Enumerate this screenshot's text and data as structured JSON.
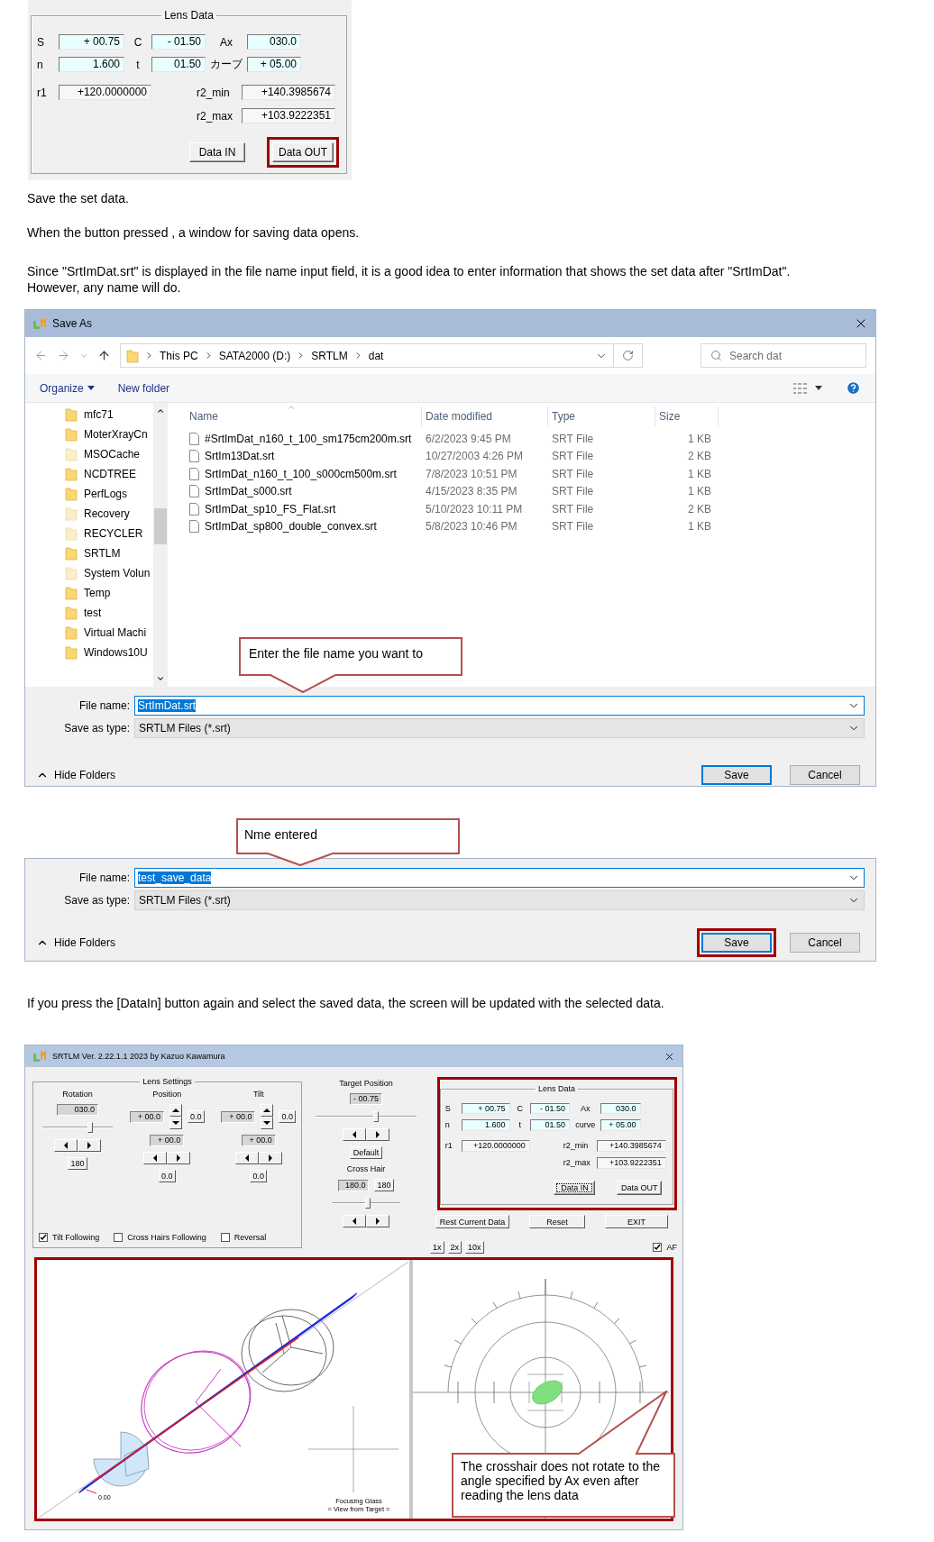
{
  "top_lens_panel": {
    "title": "Lens Data",
    "highlighted": false,
    "grid": [
      [
        {
          "label": "S",
          "value": "+ 00.75",
          "editable": true
        },
        {
          "label": "C",
          "value": "- 01.50",
          "editable": true
        },
        {
          "label": "Ax",
          "value": "030.0",
          "editable": true
        }
      ],
      [
        {
          "label": "n",
          "value": "1.600",
          "editable": true
        },
        {
          "label": "t",
          "value": "01.50",
          "editable": true
        },
        {
          "label": "カーブ",
          "value": "+ 05.00",
          "editable": true
        }
      ]
    ],
    "r1": {
      "label": "r1",
      "value": "+120.0000000",
      "editable": false
    },
    "r2": [
      {
        "label": "r2_min",
        "value": "+140.3985674",
        "editable": false
      },
      {
        "label": "r2_max",
        "value": "+103.9222351",
        "editable": false
      }
    ],
    "buttons": [
      {
        "label": "Data IN",
        "highlighted": false,
        "focused": false
      },
      {
        "label": "Data OUT",
        "highlighted": true,
        "focused": false
      }
    ]
  },
  "paragraphs_1": [
    {
      "lines": [
        "Save the set data."
      ]
    },
    {
      "lines": [
        "When the button pressed , a window for saving data opens."
      ]
    },
    {
      "lines": [
        "Since \"SrtImDat.srt\" is displayed in the file name input field, it is a good idea to enter information that shows the set data after \"SrtImDat\".",
        "However, any name will do."
      ]
    }
  ],
  "save_dialog": {
    "title": "Save As",
    "breadcrumb": [
      "This PC",
      "SATA2000 (D:)",
      "SRTLM",
      "dat"
    ],
    "search": {
      "placeholder": "Search dat"
    },
    "toolbar": [
      "Organize",
      "New folder"
    ],
    "folders": [
      {
        "name": "mfc71",
        "hidden": false
      },
      {
        "name": "MoterXrayCn",
        "hidden": false
      },
      {
        "name": "MSOCache",
        "hidden": true
      },
      {
        "name": "NCDTREE",
        "hidden": false
      },
      {
        "name": "PerfLogs",
        "hidden": false
      },
      {
        "name": "Recovery",
        "hidden": true
      },
      {
        "name": "RECYCLER",
        "hidden": true
      },
      {
        "name": "SRTLM",
        "hidden": false
      },
      {
        "name": "System Volun",
        "hidden": true
      },
      {
        "name": "Temp",
        "hidden": false
      },
      {
        "name": "test",
        "hidden": false
      },
      {
        "name": "Virtual Machi",
        "hidden": false
      },
      {
        "name": "Windows10U",
        "hidden": false
      }
    ],
    "columns": [
      "Name",
      "Date modified",
      "Type",
      "Size"
    ],
    "files": [
      {
        "name": "#SrtImDat_n160_t_100_sm175cm200m.srt",
        "date": "6/2/2023 9:45 PM",
        "type": "SRT File",
        "size": "1 KB"
      },
      {
        "name": "SrtIm13Dat.srt",
        "date": "10/27/2003 4:26 PM",
        "type": "SRT File",
        "size": "2 KB"
      },
      {
        "name": "SrtImDat_n160_t_100_s000cm500m.srt",
        "date": "7/8/2023 10:51 PM",
        "type": "SRT File",
        "size": "1 KB"
      },
      {
        "name": "SrtImDat_s000.srt",
        "date": "4/15/2023 8:35 PM",
        "type": "SRT File",
        "size": "1 KB"
      },
      {
        "name": "SrtImDat_sp10_FS_Flat.srt",
        "date": "5/10/2023 10:11 PM",
        "type": "SRT File",
        "size": "2 KB"
      },
      {
        "name": "SrtImDat_sp800_double_convex.srt",
        "date": "5/8/2023 10:46 PM",
        "type": "SRT File",
        "size": "1 KB"
      }
    ],
    "footer": {
      "file_name": {
        "label": "File name:",
        "value": "SrtImDat.srt",
        "text_selected": true
      },
      "save_as_type": {
        "label": "Save as type:",
        "value": "SRTLM Files (*.srt)"
      },
      "hide_folders": "Hide Folders",
      "buttons": [
        {
          "label": "Save",
          "default": true,
          "highlighted": false
        },
        {
          "label": "Cancel",
          "default": false,
          "highlighted": false
        }
      ]
    },
    "callout": "Enter the file name you want to"
  },
  "save_dialog_2": {
    "callout": "Nme entered",
    "footer": {
      "file_name": {
        "label": "File name:",
        "value": "test_save_data",
        "text_selected": true
      },
      "save_as_type": {
        "label": "Save as type:",
        "value": "SRTLM Files (*.srt)"
      },
      "hide_folders": "Hide Folders",
      "buttons": [
        {
          "label": "Save",
          "default": true,
          "highlighted": true
        },
        {
          "label": "Cancel",
          "default": false,
          "highlighted": false
        }
      ]
    }
  },
  "paragraph_2": "If you press the [DataIn] button again and select the saved data, the screen will be updated with the selected data.",
  "app_window": {
    "title": "SRTLM Ver. 2.22.1.1 2023 by Kazuo Kawamura",
    "lens_settings": {
      "title": "Lens Settings",
      "rotation": {
        "label": "Rotation",
        "value": "030.0",
        "level": 0.68,
        "button": "180"
      },
      "position": {
        "label": "Position",
        "value": "+ 00.0",
        "button": "0.0",
        "value_2": "+ 00.0",
        "button_2": "0.0"
      },
      "tilt": {
        "label": "Tilt",
        "value": "+ 00.0",
        "button": "0.0",
        "value_2": "+ 00.0",
        "button_2": "0.0"
      },
      "checkboxes": [
        {
          "label": "Tilt Following",
          "checked": true
        },
        {
          "label": "Cross Hairs Following",
          "checked": false
        },
        {
          "label": "Reversal",
          "checked": false
        }
      ]
    },
    "target": {
      "title": "Target Position",
      "value": "- 00.75",
      "level": 0.6,
      "button": "Default"
    },
    "cross_hair": {
      "title": "Cross Hair",
      "value": "180.0",
      "button": "180",
      "level": 0.52
    },
    "lens_data": {
      "title": "Lens Data",
      "highlighted": true,
      "grid": [
        [
          {
            "label": "S",
            "value": "+ 00.75",
            "editable": true
          },
          {
            "label": "C",
            "value": "- 01.50",
            "editable": true
          },
          {
            "label": "Ax",
            "value": "030.0",
            "editable": true
          }
        ],
        [
          {
            "label": "n",
            "value": "1.600",
            "editable": true
          },
          {
            "label": "t",
            "value": "01.50",
            "editable": true
          },
          {
            "label": "curve",
            "value": "+ 05.00",
            "editable": true
          }
        ]
      ],
      "r1": {
        "label": "r1",
        "value": "+120.0000000",
        "editable": false
      },
      "r2": [
        {
          "label": "r2_min",
          "value": "+140.3985674",
          "editable": false
        },
        {
          "label": "r2_max",
          "value": "+103.9222351",
          "editable": false
        }
      ],
      "buttons": [
        {
          "label": "Data IN",
          "highlighted": false,
          "focused": true
        },
        {
          "label": "Data OUT",
          "highlighted": false,
          "focused": false
        }
      ]
    },
    "actions": [
      "Rest Current Data",
      "Reset",
      "EXIT"
    ],
    "zoom_buttons": [
      "1x",
      "2x",
      "10x"
    ],
    "af": {
      "label": "AF",
      "checked": true
    },
    "views": {
      "highlighted": true,
      "origin_label": "0.00",
      "caption": [
        "Focusing Glass",
        "= View from Target ="
      ]
    },
    "callout": "The crosshair does not rotate to the angle specified by Ax even after reading the lens data"
  }
}
